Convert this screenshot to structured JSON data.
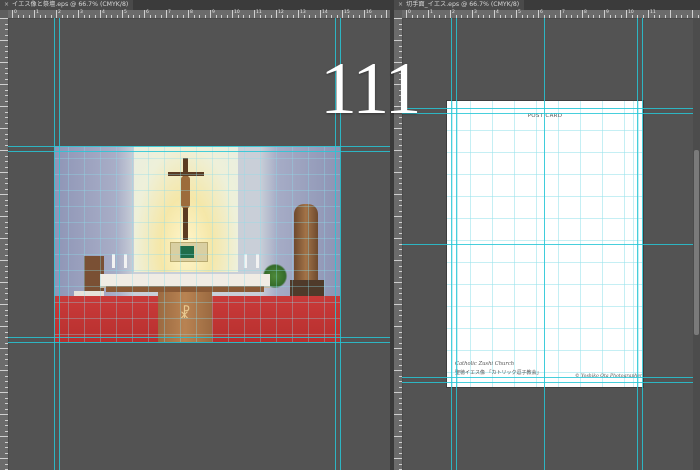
{
  "left_window": {
    "tab_title": "イエス像と祭壇.eps @ 66.7% (CMYK/8)",
    "ruler_labels": [
      "0",
      "1",
      "2",
      "3",
      "4",
      "5",
      "6",
      "7",
      "8",
      "9",
      "10",
      "11",
      "12",
      "13",
      "14",
      "15",
      "16",
      "17"
    ]
  },
  "right_window": {
    "tab_title": "切手面_イエス.eps @ 66.7% (CMYK/8)",
    "ruler_labels": [
      "0",
      "1",
      "2",
      "3",
      "4",
      "5",
      "6",
      "7",
      "8",
      "9",
      "10",
      "11"
    ]
  },
  "overlay_number": "111",
  "postcard": {
    "title": "POST CARD",
    "line1": "Catholic Zushi Church",
    "line2": "聖徳イエス像 「カトリック逗子教会」",
    "credit": "© Yoshiko Ota Photographer"
  },
  "colors": {
    "canvas_bg": "#535353",
    "guide": "#27c7d6",
    "tab_bg": "#4a4a4a",
    "postcard_bg": "#ffffff"
  },
  "icons": {
    "tab_close": "close-icon"
  }
}
